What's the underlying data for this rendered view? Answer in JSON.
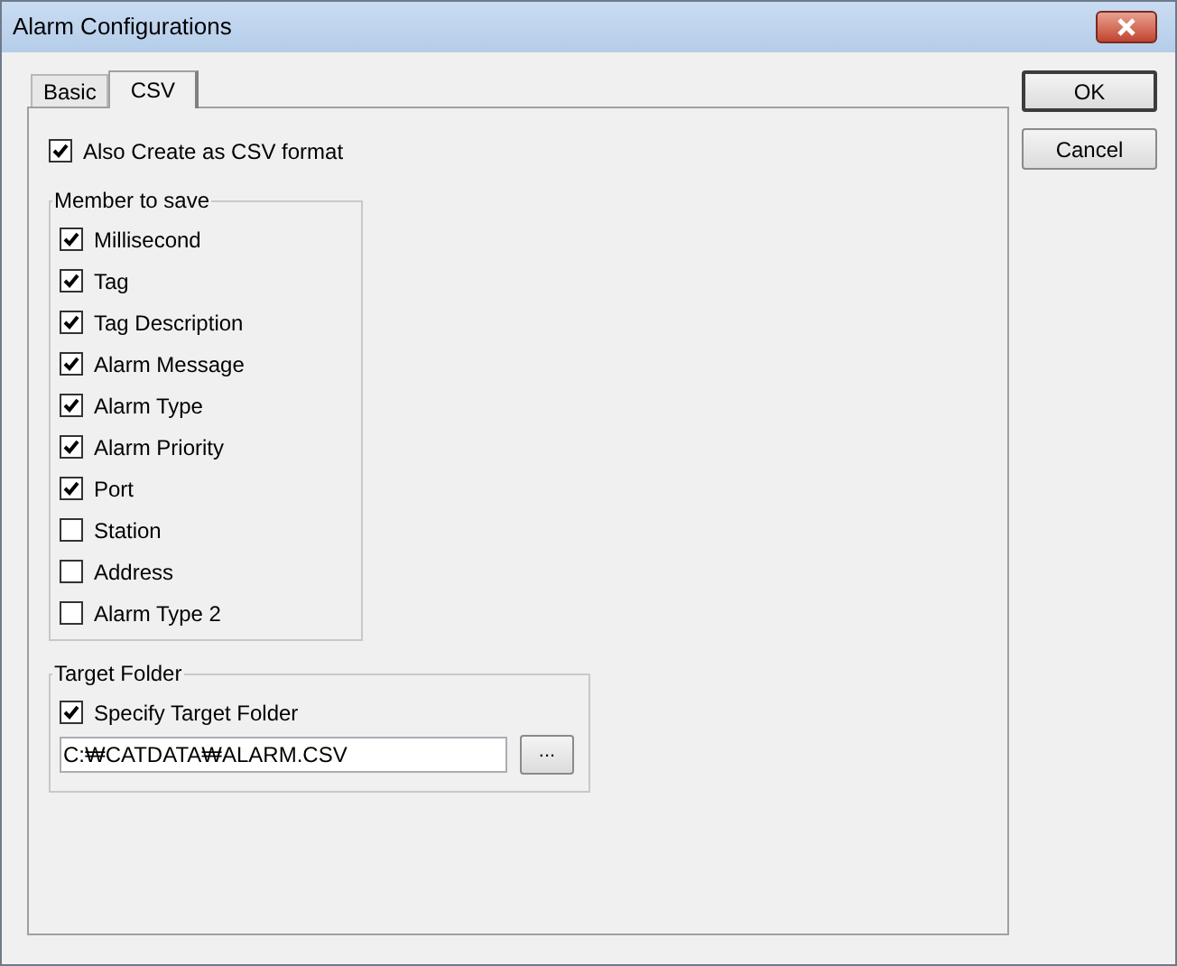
{
  "window": {
    "title": "Alarm Configurations"
  },
  "tabs": [
    {
      "label": "Basic",
      "selected": false
    },
    {
      "label": "CSV",
      "selected": true
    }
  ],
  "also_create_csv": {
    "label": "Also Create as CSV format",
    "checked": true
  },
  "member_to_save": {
    "title": "Member to save",
    "items": [
      {
        "label": "Millisecond",
        "checked": true
      },
      {
        "label": "Tag",
        "checked": true
      },
      {
        "label": "Tag Description",
        "checked": true
      },
      {
        "label": "Alarm Message",
        "checked": true
      },
      {
        "label": "Alarm Type",
        "checked": true
      },
      {
        "label": "Alarm Priority",
        "checked": true
      },
      {
        "label": "Port",
        "checked": true
      },
      {
        "label": "Station",
        "checked": false
      },
      {
        "label": "Address",
        "checked": false
      },
      {
        "label": "Alarm Type 2",
        "checked": false
      }
    ]
  },
  "target_folder": {
    "title": "Target Folder",
    "specify": {
      "label": "Specify Target Folder",
      "checked": true
    },
    "path": "C:₩CATDATA₩ALARM.CSV",
    "browse_button": "..."
  },
  "buttons": [
    "OK",
    "Cancel"
  ]
}
